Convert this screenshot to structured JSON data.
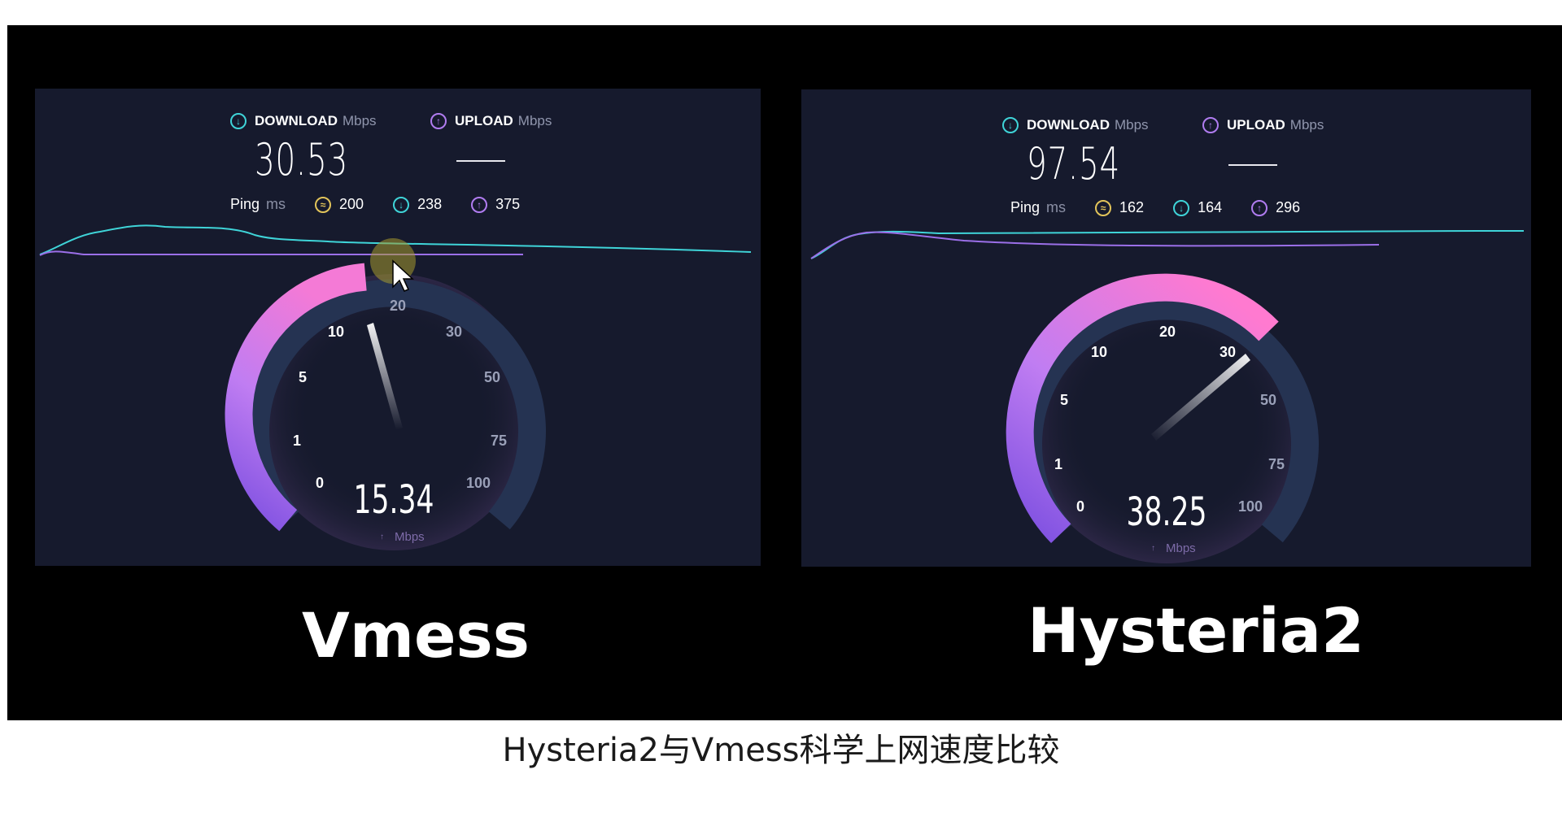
{
  "caption": "Hysteria2与Vmess科学上网速度比较",
  "panels": [
    {
      "name": "Vmess",
      "download_label": "DOWNLOAD",
      "download_unit": "Mbps",
      "download_value": "30.53",
      "upload_label": "UPLOAD",
      "upload_unit": "Mbps",
      "upload_value": "—",
      "ping_label": "Ping",
      "ping_unit": "ms",
      "ping_idle": "200",
      "ping_down": "238",
      "ping_up": "375",
      "gauge_value": "15.34",
      "gauge_unit": "Mbps",
      "gauge_ticks": [
        "0",
        "1",
        "5",
        "10",
        "20",
        "30",
        "50",
        "75",
        "100"
      ]
    },
    {
      "name": "Hysteria2",
      "download_label": "DOWNLOAD",
      "download_unit": "Mbps",
      "download_value": "97.54",
      "upload_label": "UPLOAD",
      "upload_unit": "Mbps",
      "upload_value": "—",
      "ping_label": "Ping",
      "ping_unit": "ms",
      "ping_idle": "162",
      "ping_down": "164",
      "ping_up": "296",
      "gauge_value": "38.25",
      "gauge_unit": "Mbps",
      "gauge_ticks": [
        "0",
        "1",
        "5",
        "10",
        "20",
        "30",
        "50",
        "75",
        "100"
      ]
    }
  ],
  "colors": {
    "background": "#000000",
    "panel": "#161a2d",
    "download": "#3fd4d8",
    "upload": "#b07cf0",
    "ping": "#e2c45a",
    "gauge_fill_start": "#8b5cf6",
    "gauge_fill_end": "#f472d0",
    "gauge_track": "#253352"
  },
  "icons": {
    "download": "arrow-down-circle-icon",
    "upload": "arrow-up-circle-icon",
    "ping": "ping-circle-icon",
    "cursor": "mouse-pointer-icon"
  }
}
